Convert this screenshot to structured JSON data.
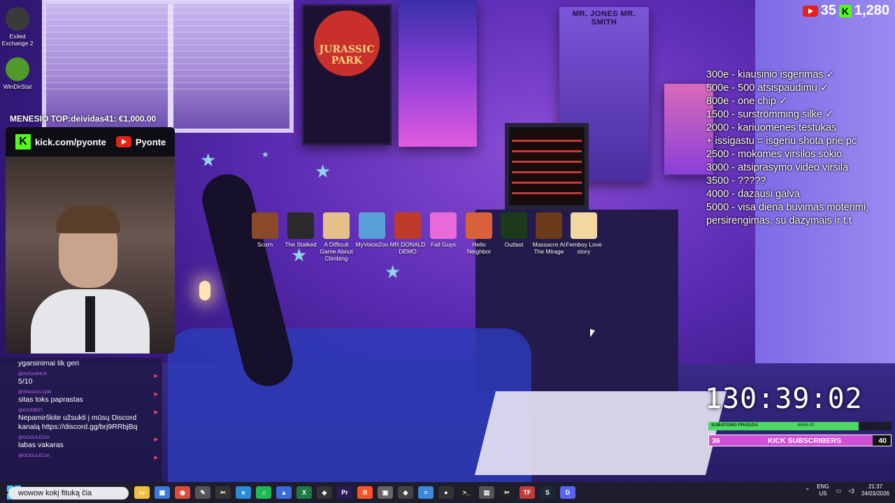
{
  "desktop_left_icons": [
    {
      "label": "Exiled Exchange 2",
      "color": "#3a3a3a"
    },
    {
      "label": "WinDirStat",
      "color": "#4f9a2a"
    }
  ],
  "desktop_icons": [
    {
      "label": "Scorn",
      "color": "#8a4a2a"
    },
    {
      "label": "The Stalked",
      "color": "#2a2a2a"
    },
    {
      "label": "A Difficult Game About Climbing",
      "color": "#e6c08a"
    },
    {
      "label": "MyVoiceZoo",
      "color": "#5aa0d8"
    },
    {
      "label": "MR DONALD DEMO",
      "color": "#c03a2a"
    },
    {
      "label": "Fall Guys",
      "color": "#e86ad8"
    },
    {
      "label": "Hello Neighbor",
      "color": "#d8603a"
    },
    {
      "label": "Outlast",
      "color": "#1a3a1a"
    },
    {
      "label": "Massacre At The Mirage",
      "color": "#6a3a1a"
    },
    {
      "label": "Femboy Love story",
      "color": "#f0d8a0"
    }
  ],
  "counter": {
    "youtube": "35",
    "kick": "1,280"
  },
  "goals": [
    "300e - kiausinio isgerimas ✓",
    "500e - 500 atsispaudimu ✓",
    "800e - one chip ✓",
    "1500 - surströmming silke ✓",
    "2000 - kariuomenes testukas",
    "+ issigastu = isgeriu shota prie pc",
    "2500 - mokomes virsilos sokio",
    "3000 - atsiprasymo video virsila",
    "3500 - ?????",
    "4000 - dazausi galva",
    "5000 - visa diena buvimas moterimi,",
    "persirengimas, su dazymais ir t.t"
  ],
  "top_donor": "MENESIO TOP:deividas41: €1,000.00",
  "channels": {
    "kick": "kick.com/pyonte",
    "youtube": "Pyonte"
  },
  "chat": [
    {
      "user": "",
      "text": "ygarsinimai tik geri"
    },
    {
      "user": "@AVIDARIUS",
      "text": "5/10"
    },
    {
      "user": "@SNAXAS-Q98",
      "text": "sitas toks paprastas"
    },
    {
      "user": "@KICKBOT",
      "text": "Nepamirškite užsukti į mūsų Discord kanalą https://discord.gg/brj9RRbjBq"
    },
    {
      "user": "@GODULECIA",
      "text": "labas vakaras"
    },
    {
      "user": "@GODULECIA",
      "text": ""
    }
  ],
  "timer": "130:39:02",
  "sub_goal": {
    "label": "SUBATONO PRADZIA",
    "current": "€696.00",
    "target": "€900",
    "progress": 0.82
  },
  "kick_goal": {
    "current": "36",
    "label": "KICK SUBSCRIBERS",
    "target": "40",
    "progress": 0.9
  },
  "taskbar": {
    "search_text": "wowow kokį fituką čia",
    "icons": [
      {
        "name": "file-explorer-icon",
        "glyph": "▭",
        "color": "#f0c040"
      },
      {
        "name": "store-icon",
        "glyph": "▦",
        "color": "#3a7ad8"
      },
      {
        "name": "chrome-icon",
        "glyph": "◉",
        "color": "#e04a3a"
      },
      {
        "name": "notepad-icon",
        "glyph": "✎",
        "color": "#555"
      },
      {
        "name": "capcut-icon",
        "glyph": "✂",
        "color": "#333"
      },
      {
        "name": "edge-icon",
        "glyph": "e",
        "color": "#2a8ad8"
      },
      {
        "name": "spotify-icon",
        "glyph": "♫",
        "color": "#1db954"
      },
      {
        "name": "photos-icon",
        "glyph": "▲",
        "color": "#3a6ad8"
      },
      {
        "name": "excel-icon",
        "glyph": "X",
        "color": "#1d7a45"
      },
      {
        "name": "davinci-icon",
        "glyph": "◈",
        "color": "#333"
      },
      {
        "name": "premiere-icon",
        "glyph": "Pr",
        "color": "#2a1a5a"
      },
      {
        "name": "brave-icon",
        "glyph": "B",
        "color": "#fb542b"
      },
      {
        "name": "app-icon-1",
        "glyph": "▣",
        "color": "#666"
      },
      {
        "name": "app-icon-2",
        "glyph": "◆",
        "color": "#444"
      },
      {
        "name": "notes-icon",
        "glyph": "≡",
        "color": "#3a8ad8"
      },
      {
        "name": "obs-icon",
        "glyph": "●",
        "color": "#333"
      },
      {
        "name": "terminal-icon",
        "glyph": ">_",
        "color": "#222"
      },
      {
        "name": "app-icon-3",
        "glyph": "▤",
        "color": "#555"
      },
      {
        "name": "capcut-icon-2",
        "glyph": "✂",
        "color": "#222"
      },
      {
        "name": "tf-icon",
        "glyph": "TF",
        "color": "#c03a3a"
      },
      {
        "name": "steam-icon",
        "glyph": "S",
        "color": "#1b2838"
      },
      {
        "name": "discord-icon",
        "glyph": "D",
        "color": "#5865f2"
      }
    ],
    "lang": "ENG",
    "region": "US",
    "time": "21:37",
    "date": "24/03/2026"
  }
}
